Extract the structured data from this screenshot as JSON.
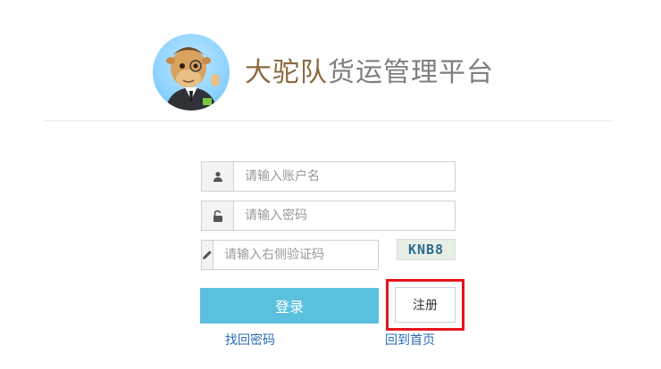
{
  "header": {
    "brand": "大驼队",
    "subtitle": "货运管理平台",
    "logo_icon": "camel-mascot-icon"
  },
  "form": {
    "username": {
      "placeholder": "请输入账户名",
      "value": "",
      "icon": "user-icon"
    },
    "password": {
      "placeholder": "请输入密码",
      "value": "",
      "icon": "unlock-icon"
    },
    "captcha_input": {
      "placeholder": "请输入右侧验证码",
      "value": "",
      "icon": "pencil-icon"
    },
    "captcha_text": "KNB8"
  },
  "actions": {
    "login_label": "登录",
    "register_label": "注册",
    "forgot_label": "找回密码",
    "home_label": "回到首页"
  },
  "colors": {
    "accent": "#5bc0de",
    "link": "#2a6bb5",
    "highlight": "#e5141c",
    "brand_text": "#8b6a3f",
    "muted_text": "#7e7e7e"
  }
}
